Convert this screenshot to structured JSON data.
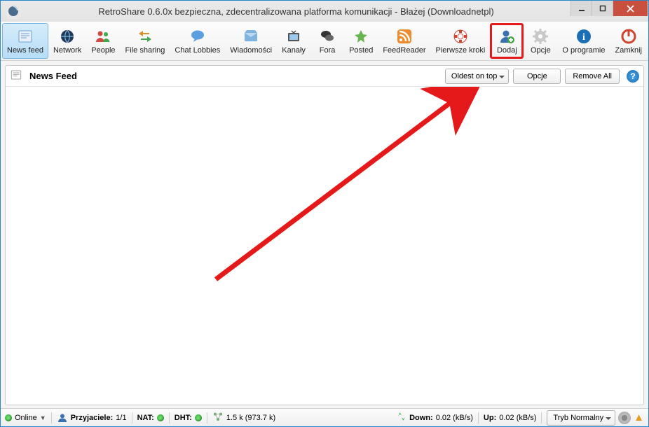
{
  "window": {
    "title": "RetroShare 0.6.0x bezpieczna, zdecentralizowana platforma komunikacji - Błażej (Downloadnetpl)"
  },
  "toolbar": {
    "items": [
      {
        "label": "News feed"
      },
      {
        "label": "Network"
      },
      {
        "label": "People"
      },
      {
        "label": "File sharing"
      },
      {
        "label": "Chat Lobbies"
      },
      {
        "label": "Wiadomości"
      },
      {
        "label": "Kanały"
      },
      {
        "label": "Fora"
      },
      {
        "label": "Posted"
      },
      {
        "label": "FeedReader"
      },
      {
        "label": "Pierwsze kroki"
      },
      {
        "label": "Dodaj"
      },
      {
        "label": "Opcje"
      },
      {
        "label": "O programie"
      },
      {
        "label": "Zamknij"
      }
    ]
  },
  "panel": {
    "title": "News Feed",
    "sort_selected": "Oldest on top",
    "options_btn": "Opcje",
    "remove_all_btn": "Remove All"
  },
  "status": {
    "online_label": "Online",
    "friends_label": "Przyjaciele:",
    "friends_count": "1/1",
    "nat_label": "NAT:",
    "dht_label": "DHT:",
    "rate_text": "1.5 k (973.7 k)",
    "down_label": "Down:",
    "down_value": "0.02 (kB/s)",
    "up_label": "Up:",
    "up_value": "0.02 (kB/s)",
    "mode_label": "Tryb Normalny"
  }
}
